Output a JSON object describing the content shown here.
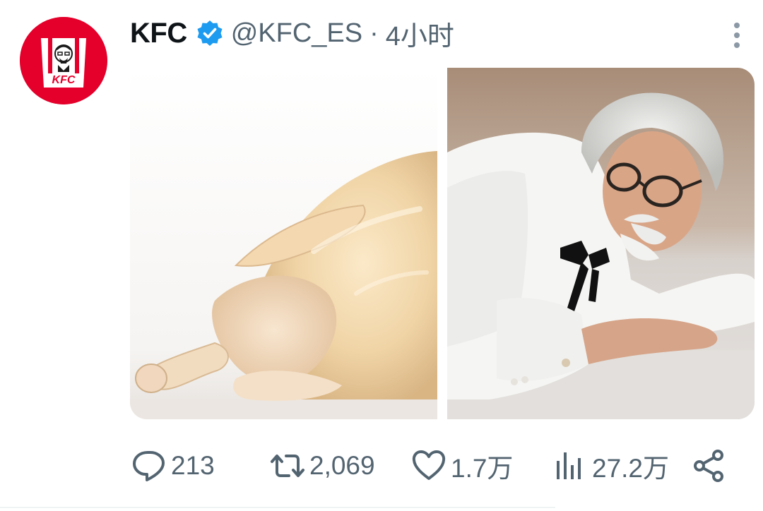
{
  "tweet": {
    "avatar_icon": "kfc-logo-icon",
    "avatar_logo_text": "KFC",
    "display_name": "KFC",
    "verified_icon": "verified-badge-icon",
    "handle": "@KFC_ES",
    "separator": "·",
    "time": "4小时",
    "more_icon": "more-vertical-icon",
    "media": [
      {
        "icon": "raw-chicken-photo"
      },
      {
        "icon": "colonel-lying-photo"
      }
    ],
    "actions": {
      "reply": {
        "icon": "reply-icon",
        "count": "213"
      },
      "retweet": {
        "icon": "retweet-icon",
        "count": "2,069"
      },
      "like": {
        "icon": "heart-icon",
        "count": "1.7万"
      },
      "views": {
        "icon": "views-icon",
        "count": "27.2万"
      },
      "share": {
        "icon": "share-icon"
      }
    },
    "colors": {
      "brand_red": "#e4002b",
      "verified_blue": "#1d9bf0",
      "secondary_text": "#536471",
      "icon_gray": "#536471"
    }
  }
}
